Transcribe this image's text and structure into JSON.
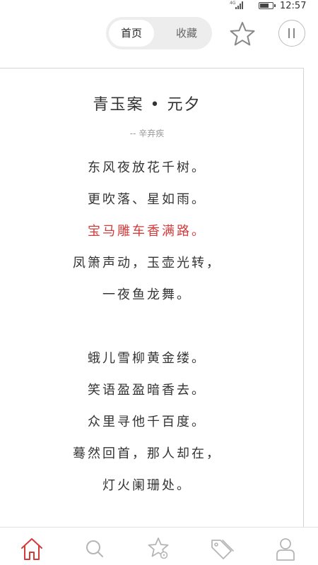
{
  "status_bar": {
    "network": "4G",
    "time": "12:57",
    "battery_level": 0.75
  },
  "header": {
    "tabs": [
      {
        "label": "首页",
        "active": true
      },
      {
        "label": "收藏",
        "active": false
      }
    ]
  },
  "poem": {
    "title": "青玉案 • 元夕",
    "author": "-- 辛弃疾",
    "lines": [
      "东风夜放花千树。",
      "更吹落、星如雨。",
      "宝马雕车香满路。",
      "凤箫声动，玉壶光转，",
      "一夜鱼龙舞。",
      "蛾儿雪柳黄金缕。",
      "笑语盈盈暗香去。",
      "众里寻他千百度。",
      "蓦然回首，那人却在，",
      "灯火阑珊处。"
    ],
    "highlighted_line_index": 2
  },
  "bottom_nav": {
    "items": [
      "home-icon",
      "search-icon",
      "star-settings-icon",
      "tags-icon",
      "profile-icon"
    ],
    "active_index": 0
  },
  "colors": {
    "accent": "#d23b3b",
    "text": "#333333",
    "muted": "#999999",
    "icon": "#b5b5b5"
  }
}
